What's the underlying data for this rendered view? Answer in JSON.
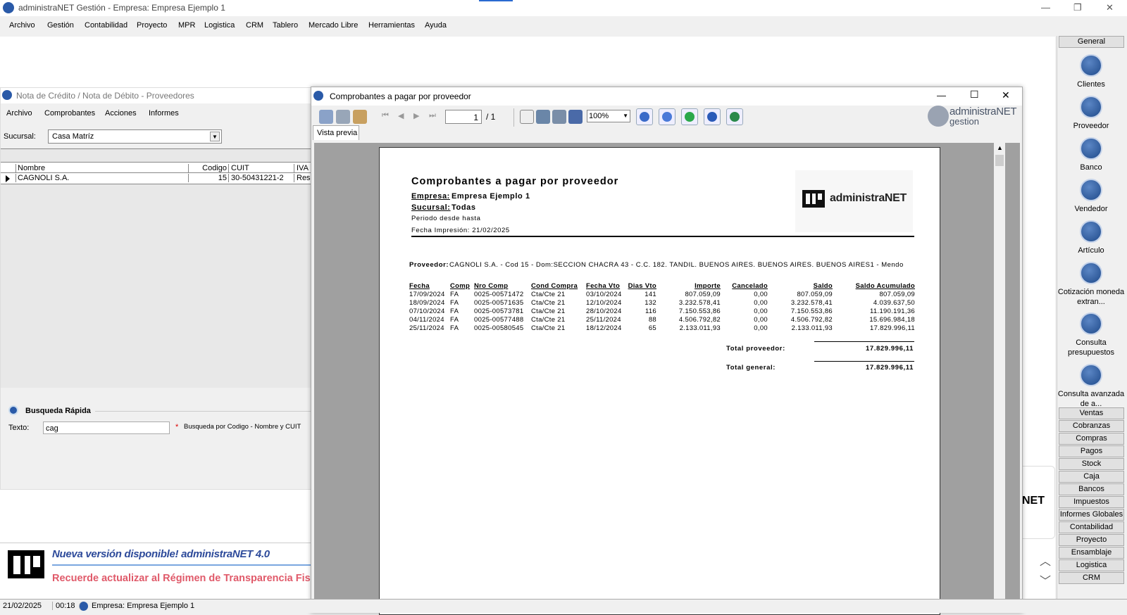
{
  "app": {
    "title": "administraNET Gestión - Empresa: Empresa Ejemplo 1",
    "menu": [
      "Archivo",
      "Gestión",
      "Contabilidad",
      "Proyecto",
      "MPR",
      "Logistica",
      "CRM",
      "Tablero",
      "Mercado Libre",
      "Herramientas",
      "Ayuda"
    ]
  },
  "nota": {
    "title": "Nota de Crédito / Nota de Débito - Proveedores",
    "menu": [
      "Archivo",
      "Comprobantes",
      "Acciones",
      "Informes"
    ],
    "sucursal_label": "Sucursal:",
    "sucursal_value": "Casa Matríz",
    "columns": [
      "Nombre",
      "Codigo",
      "CUIT",
      "IVA"
    ],
    "row": {
      "nombre": "CAGNOLI S.A.",
      "codigo": "15",
      "cuit": "30-50431221-2",
      "iva": "Res"
    },
    "busqueda_title": "Busqueda Rápida",
    "texto_label": "Texto:",
    "texto_value": "cag",
    "busqueda_hint": "Busqueda por Codigo - Nombre y CUIT"
  },
  "report": {
    "title": "Comprobantes a pagar por proveedor",
    "page_input": "1",
    "page_total": "/ 1",
    "zoom": "100%",
    "tab": "Vista previa",
    "logo_text_1": "administraNET",
    "logo_text_2": "gestion",
    "paper": {
      "heading": "Comprobantes a pagar por proveedor",
      "empresa_label": "Empresa:",
      "empresa_value": "Empresa Ejemplo 1",
      "sucursal_label": "Sucursal:",
      "sucursal_value": "Todas",
      "periodo": "Periodo desde   hasta",
      "fecha_impresion": "Fecha Impresión: 21/02/2025",
      "brand": "administraNET",
      "proveedor_label": "Proveedor:",
      "proveedor_value": "CAGNOLI S.A. - Cod 15 - Dom:SECCION CHACRA 43 - C.C. 182. TANDIL. BUENOS AIRES. BUENOS AIRES. BUENOS AIRES1 - Mendo",
      "columns": [
        "Fecha",
        "Comp",
        "Nro Comp",
        "Cond Compra",
        "Fecha Vto",
        "Dias Vto",
        "Importe",
        "Cancelado",
        "Saldo",
        "Saldo Acumulado"
      ],
      "rows": [
        [
          "17/09/2024",
          "FA",
          "0025-00571472",
          "Cta/Cte 21",
          "03/10/2024",
          "141",
          "807.059,09",
          "0,00",
          "807.059,09",
          "807.059,09"
        ],
        [
          "18/09/2024",
          "FA",
          "0025-00571635",
          "Cta/Cte 21",
          "12/10/2024",
          "132",
          "3.232.578,41",
          "0,00",
          "3.232.578,41",
          "4.039.637,50"
        ],
        [
          "07/10/2024",
          "FA",
          "0025-00573781",
          "Cta/Cte 21",
          "28/10/2024",
          "116",
          "7.150.553,86",
          "0,00",
          "7.150.553,86",
          "11.190.191,36"
        ],
        [
          "04/11/2024",
          "FA",
          "0025-00577488",
          "Cta/Cte 21",
          "25/11/2024",
          "88",
          "4.506.792,82",
          "0,00",
          "4.506.792,82",
          "15.696.984,18"
        ],
        [
          "25/11/2024",
          "FA",
          "0025-00580545",
          "Cta/Cte 21",
          "18/12/2024",
          "65",
          "2.133.011,93",
          "0,00",
          "2.133.011,93",
          "17.829.996,11"
        ]
      ],
      "total_proveedor_label": "Total proveedor:",
      "total_proveedor_value": "17.829.996,11",
      "total_general_label": "Total general:",
      "total_general_value": "17.829.996,11"
    }
  },
  "sidebar": {
    "general": "General",
    "items": [
      "Clientes",
      "Proveedor",
      "Banco",
      "Vendedor",
      "Artículo",
      "Cotización moneda extran...",
      "Consulta presupuestos",
      "Consulta avanzada de a..."
    ],
    "sections": [
      "Ventas",
      "Cobranzas",
      "Compras",
      "Pagos",
      "Stock",
      "Caja",
      "Bancos",
      "Impuestos",
      "Informes Globales",
      "Contabilidad",
      "Proyecto",
      "Ensamblaje",
      "Logistica",
      "CRM"
    ]
  },
  "banner": {
    "line1": "Nueva versión disponible! administraNET 4.0",
    "line2": "Recuerde actualizar al Régimen de Transparencia Fis",
    "behind_logo": "NET"
  },
  "status": {
    "date": "21/02/2025",
    "time": "00:18",
    "empresa": "Empresa: Empresa Ejemplo 1"
  }
}
